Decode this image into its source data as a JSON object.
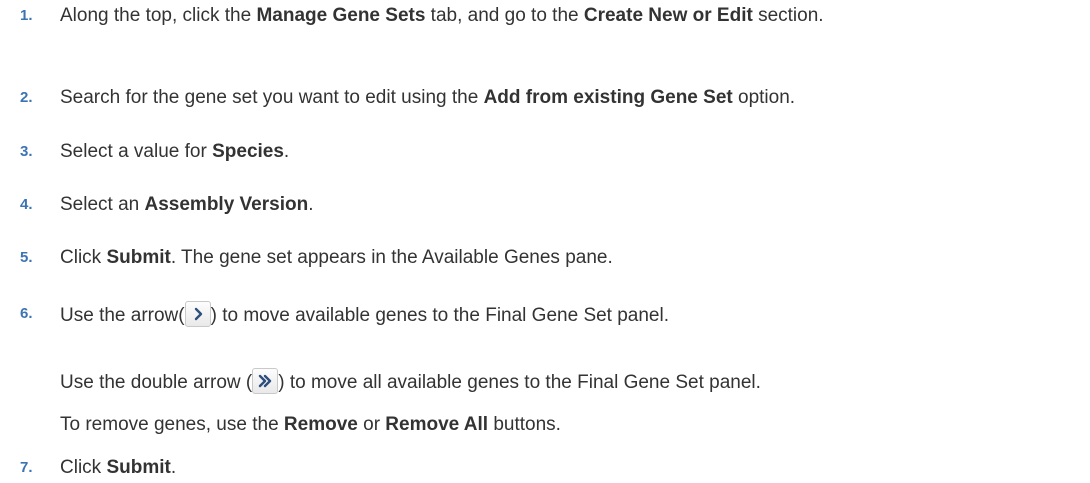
{
  "steps": [
    {
      "number": "1.",
      "segments": [
        {
          "text": "Along the top, click the ",
          "bold": false
        },
        {
          "text": "Manage Gene Sets",
          "bold": true
        },
        {
          "text": " tab, and go to the ",
          "bold": false
        },
        {
          "text": "Create New or Edit",
          "bold": true
        },
        {
          "text": " section.",
          "bold": false
        }
      ]
    },
    {
      "number": "2.",
      "segments": [
        {
          "text": "Search for the gene set you want to edit using the ",
          "bold": false
        },
        {
          "text": "Add from existing Gene Set",
          "bold": true
        },
        {
          "text": " option.",
          "bold": false
        }
      ]
    },
    {
      "number": "3.",
      "segments": [
        {
          "text": "Select a value for ",
          "bold": false
        },
        {
          "text": "Species",
          "bold": true
        },
        {
          "text": ".",
          "bold": false
        }
      ]
    },
    {
      "number": "4.",
      "segments": [
        {
          "text": "Select an ",
          "bold": false
        },
        {
          "text": "Assembly Version",
          "bold": true
        },
        {
          "text": ".",
          "bold": false
        }
      ]
    },
    {
      "number": "5.",
      "segments": [
        {
          "text": "Click ",
          "bold": false
        },
        {
          "text": "Submit",
          "bold": true
        },
        {
          "text": ". The gene set appears in the Available Genes pane.",
          "bold": false
        }
      ]
    },
    {
      "number": "6.",
      "segments": [
        {
          "text": "Use the arrow(",
          "bold": false
        },
        {
          "icon": "single-arrow-right"
        },
        {
          "text": ") to move available genes to the Final Gene Set panel.",
          "bold": false
        }
      ]
    },
    {
      "number": "7.",
      "segments": [
        {
          "text": "Click ",
          "bold": false
        },
        {
          "text": "Submit",
          "bold": true
        },
        {
          "text": ".",
          "bold": false
        }
      ]
    }
  ],
  "step6_extra": [
    {
      "segments": [
        {
          "text": "Use the double arrow (",
          "bold": false
        },
        {
          "icon": "double-arrow-right"
        },
        {
          "text": ") to move all available genes to the Final Gene Set panel.",
          "bold": false
        }
      ]
    },
    {
      "segments": [
        {
          "text": "To remove genes, use the ",
          "bold": false
        },
        {
          "text": "Remove",
          "bold": true
        },
        {
          "text": " or ",
          "bold": false
        },
        {
          "text": "Remove All",
          "bold": true
        },
        {
          "text": " buttons.",
          "bold": false
        }
      ]
    }
  ],
  "colors": {
    "number": "#3c74b3",
    "text": "#333333",
    "icon_border": "#c9c9c9",
    "icon_glyph": "#2d4f7c"
  }
}
